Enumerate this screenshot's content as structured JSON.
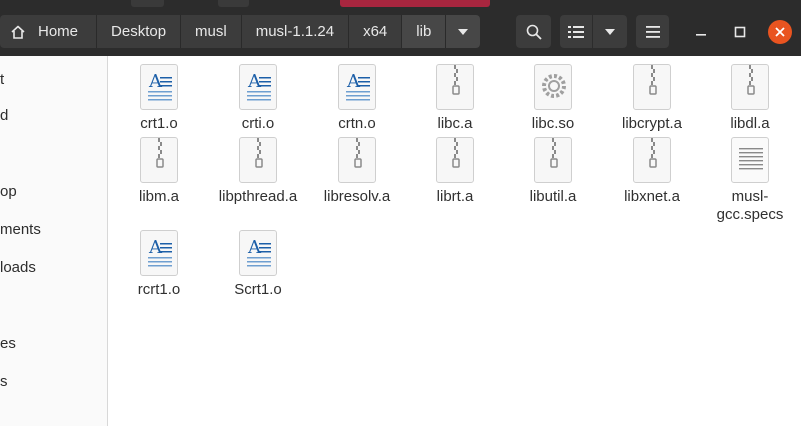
{
  "breadcrumbs": [
    "Home",
    "Desktop",
    "musl",
    "musl-1.1.24",
    "x64",
    "lib"
  ],
  "sidebar": {
    "items": [
      "t",
      "d",
      "op",
      "ments",
      "loads",
      "es",
      "s"
    ]
  },
  "files": [
    {
      "name": "crt1.o",
      "icon": "object-file-icon"
    },
    {
      "name": "crti.o",
      "icon": "object-file-icon"
    },
    {
      "name": "crtn.o",
      "icon": "object-file-icon"
    },
    {
      "name": "libc.a",
      "icon": "archive-icon"
    },
    {
      "name": "libc.so",
      "icon": "shared-library-icon"
    },
    {
      "name": "libcrypt.a",
      "icon": "archive-icon"
    },
    {
      "name": "libdl.a",
      "icon": "archive-icon"
    },
    {
      "name": "libm.a",
      "icon": "archive-icon"
    },
    {
      "name": "libpthread.a",
      "icon": "archive-icon"
    },
    {
      "name": "libresolv.a",
      "icon": "archive-icon"
    },
    {
      "name": "librt.a",
      "icon": "archive-icon"
    },
    {
      "name": "libutil.a",
      "icon": "archive-icon"
    },
    {
      "name": "libxnet.a",
      "icon": "archive-icon"
    },
    {
      "name": "musl-gcc.specs",
      "icon": "text-file-icon"
    },
    {
      "name": "rcrt1.o",
      "icon": "object-file-icon"
    },
    {
      "name": "Scrt1.o",
      "icon": "object-file-icon"
    }
  ],
  "colors": {
    "header_bg": "#2c2c2c",
    "close_button": "#e95420",
    "object_icon_letter": "#1c5fa8"
  }
}
